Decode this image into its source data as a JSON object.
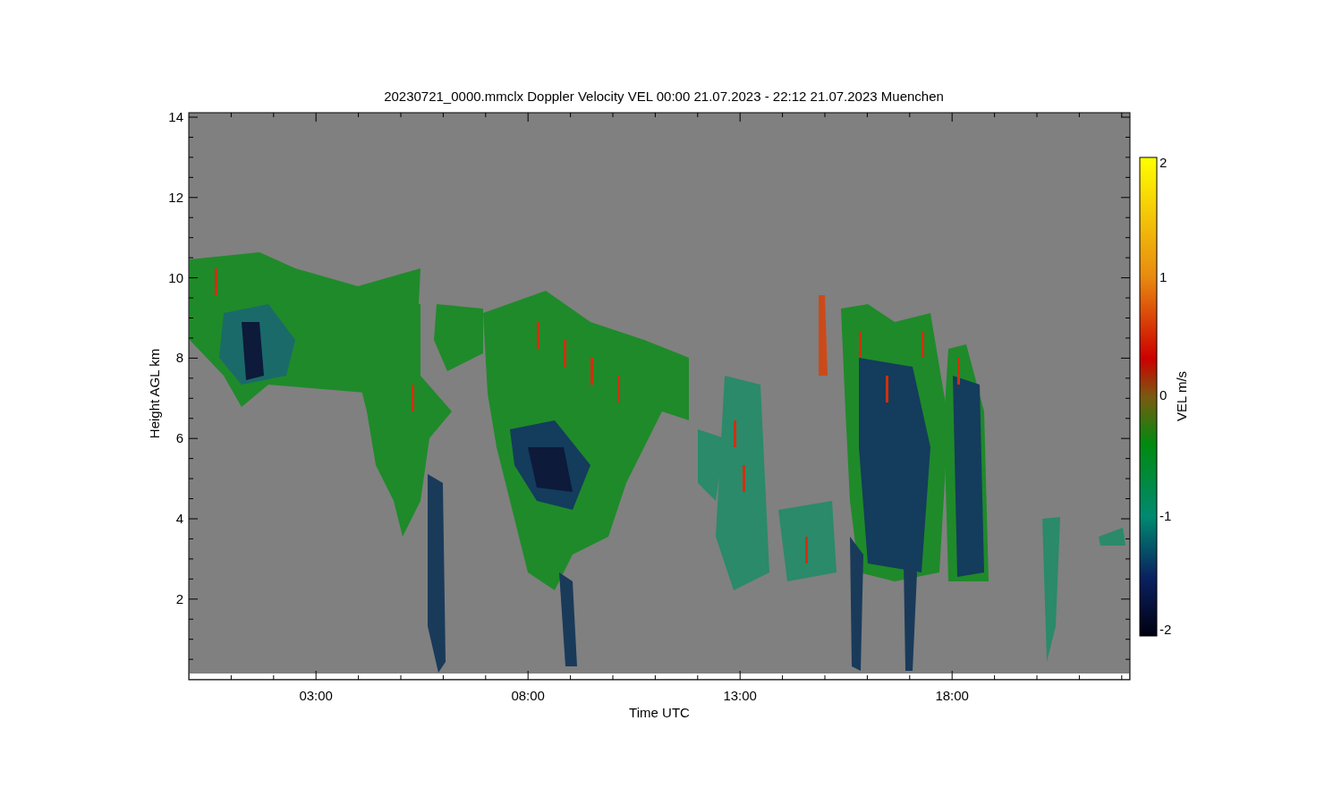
{
  "title": "20230721_0000.mmclx Doppler Velocity VEL   00:00 21.07.2023 - 22:12 21.07.2023 Muenchen",
  "y_axis": {
    "label": "Height AGL km",
    "ticks": [
      "14",
      "12",
      "10",
      "8",
      "6",
      "4",
      "2"
    ]
  },
  "x_axis": {
    "label": "Time UTC",
    "ticks": [
      "03:00",
      "08:00",
      "13:00",
      "18:00"
    ]
  },
  "colorbar": {
    "label": "VEL m/s",
    "ticks": [
      "2",
      "1",
      "0",
      "-1",
      "-2"
    ]
  }
}
